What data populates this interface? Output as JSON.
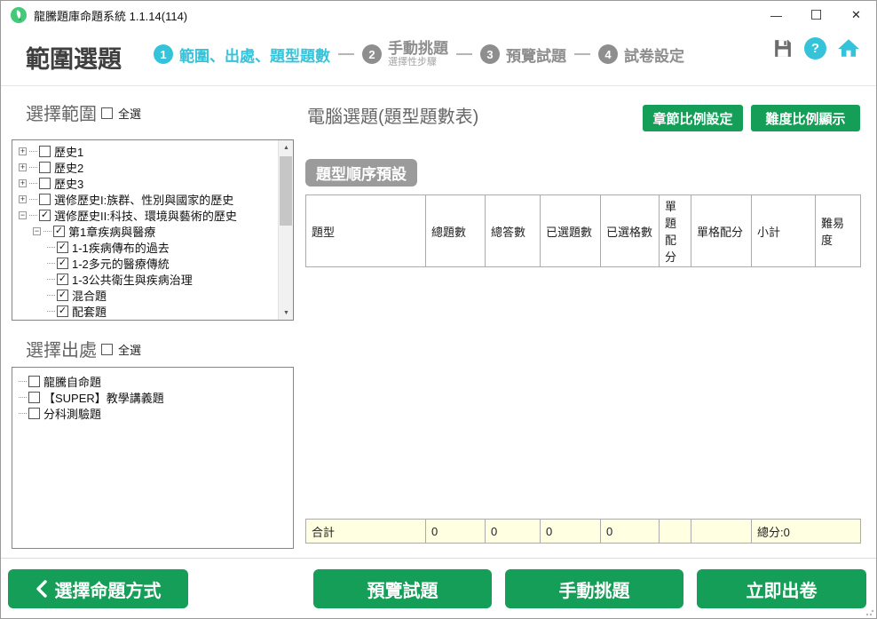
{
  "window": {
    "title": "龍騰題庫命題系統 1.1.14(114)",
    "controls": {
      "minimize": "—",
      "maximize": "☐",
      "close": "✕"
    }
  },
  "header": {
    "page_title": "範圍選題",
    "steps": [
      {
        "num": "1",
        "label": "範圍、出處、題型題數",
        "sub": ""
      },
      {
        "num": "2",
        "label": "手動挑題",
        "sub": "選擇性步驟"
      },
      {
        "num": "3",
        "label": "預覽試題",
        "sub": ""
      },
      {
        "num": "4",
        "label": "試卷設定",
        "sub": ""
      }
    ]
  },
  "scope": {
    "title": "選擇範圍",
    "select_all_label": "全選",
    "select_all_check": "",
    "tree": [
      {
        "expander": "+",
        "check": "",
        "label": "歷史1"
      },
      {
        "expander": "+",
        "check": "",
        "label": "歷史2"
      },
      {
        "expander": "+",
        "check": "",
        "label": "歷史3"
      },
      {
        "expander": "+",
        "check": "",
        "label": "選修歷史I:族群、性別與國家的歷史"
      },
      {
        "expander": "−",
        "check": "✓",
        "label": "選修歷史II:科技、環境與藝術的歷史"
      },
      {
        "expander": "−",
        "check": "✓",
        "label": "第1章疾病與醫療"
      },
      {
        "expander": "",
        "check": "✓",
        "label": "1-1疾病傳布的過去"
      },
      {
        "expander": "",
        "check": "✓",
        "label": "1-2多元的醫療傳統"
      },
      {
        "expander": "",
        "check": "✓",
        "label": "1-3公共衛生與疾病治理"
      },
      {
        "expander": "",
        "check": "✓",
        "label": "混合題"
      },
      {
        "expander": "",
        "check": "✓",
        "label": "配套題"
      }
    ],
    "scroll_up": "▲",
    "scroll_down": "▼"
  },
  "source": {
    "title": "選擇出處",
    "select_all_label": "全選",
    "select_all_check": "",
    "items": [
      {
        "check": "",
        "label": "龍騰自命題"
      },
      {
        "check": "",
        "label": "【SUPER】教學講義題"
      },
      {
        "check": "",
        "label": "分科測驗題"
      }
    ]
  },
  "main": {
    "title": "電腦選題(題型題數表)",
    "chapter_ratio_button": "章節比例設定",
    "difficulty_ratio_button": "難度比例顯示",
    "type_order_button": "題型順序預設",
    "table": {
      "headers": [
        "題型",
        "總題數",
        "總答數",
        "已選題數",
        "已選格數",
        "單題配分",
        "單格配分",
        "小計",
        "難易度"
      ],
      "footer": {
        "label": "合計",
        "total_questions": "0",
        "total_answers": "0",
        "selected_questions": "0",
        "selected_cells": "0",
        "per_question_score": "",
        "per_cell_score": "",
        "total_score": "總分:0"
      }
    }
  },
  "bottom": {
    "back_button": "選擇命題方式",
    "preview_button": "預覽試題",
    "manual_button": "手動挑題",
    "generate_button": "立即出卷"
  },
  "colors": {
    "accent_green": "#149e57",
    "accent_cyan": "#35c3da",
    "footer_row_yellow": "#ffffe1",
    "inactive_gray": "#8e8e8e"
  }
}
